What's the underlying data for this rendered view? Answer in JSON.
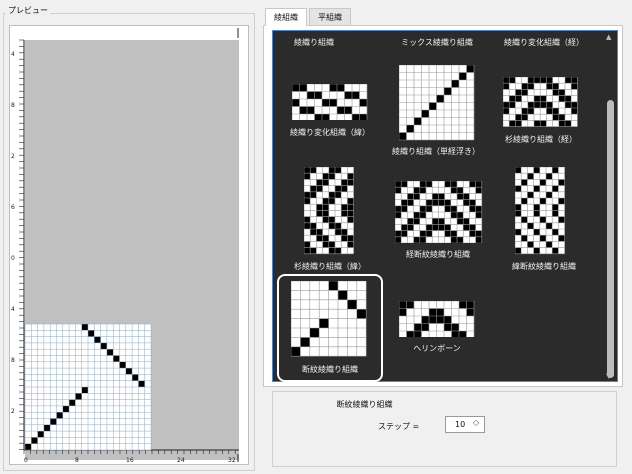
{
  "preview": {
    "title": "プレビュー",
    "ruler_top_numbers": [
      "4",
      "8",
      "2",
      "6",
      "0",
      "4",
      "8",
      "2"
    ],
    "ruler_bottom_numbers": [
      "0",
      "8",
      "16",
      "24",
      "32"
    ]
  },
  "tabs": [
    {
      "label": "綾組織",
      "active": true
    },
    {
      "label": "平組織",
      "active": false
    }
  ],
  "patterns": {
    "header_labels": [
      "綾織り組織",
      "ミックス綾織り組織",
      "綾織り変化組織（経）"
    ],
    "items": [
      {
        "label": "綾織り変化組織（緯）"
      },
      {
        "label": "綾織り組織（単経浮き）"
      },
      {
        "label": "杉綾織り組織（経）"
      },
      {
        "label": "杉綾織り組織（緯）"
      },
      {
        "label": "経断紋綾織り組織"
      },
      {
        "label": "緯断紋綾織り組織"
      },
      {
        "label": "断紋綾織り組織",
        "selected": true
      },
      {
        "label": "ヘリンボーン"
      }
    ]
  },
  "info": {
    "selected_name": "断紋綾織り組織",
    "step_label": "ステップ =",
    "step_value": "10"
  },
  "colors": {
    "list_bg": "#2b2b2b",
    "selection_border": "#4a86d4",
    "grid_line": "#8ca8c8"
  }
}
